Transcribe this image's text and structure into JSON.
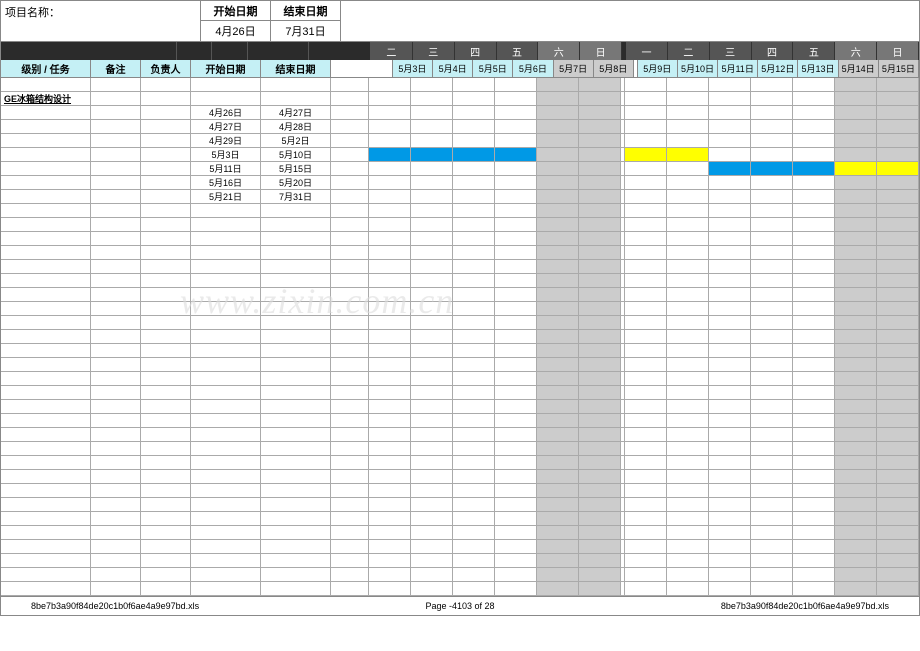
{
  "header": {
    "project_label": "项目名称：",
    "start_date_label": "开始日期",
    "end_date_label": "结束日期",
    "start_date": "4月26日",
    "end_date": "7月31日"
  },
  "columns": {
    "level_task": "级别 / 任务",
    "remark": "备注",
    "owner": "负责人",
    "start": "开始日期",
    "end": "结束日期"
  },
  "day_labels": [
    "二",
    "三",
    "四",
    "五",
    "六",
    "日",
    "一",
    "二",
    "三",
    "四",
    "五",
    "六",
    "日"
  ],
  "day_weekend": [
    false,
    false,
    false,
    false,
    true,
    true,
    false,
    false,
    false,
    false,
    false,
    true,
    true
  ],
  "date_labels": [
    "5月3日",
    "5月4日",
    "5月5日",
    "5月6日",
    "5月7日",
    "5月8日",
    "5月9日",
    "5月10日",
    "5月11日",
    "5月12日",
    "5月13日",
    "5月14日",
    "5月15日"
  ],
  "section_title": "GE冰箱结构设计",
  "tasks": [
    {
      "start": "4月26日",
      "end": "4月27日",
      "bars": []
    },
    {
      "start": "4月27日",
      "end": "4月28日",
      "bars": []
    },
    {
      "start": "4月29日",
      "end": "5月2日",
      "bars": []
    },
    {
      "start": "5月3日",
      "end": "5月10日",
      "bars": [
        {
          "from": 0,
          "to": 3,
          "color": "blue"
        },
        {
          "from": 6,
          "to": 7,
          "color": "yellow"
        }
      ]
    },
    {
      "start": "5月11日",
      "end": "5月15日",
      "bars": [
        {
          "from": 8,
          "to": 10,
          "color": "blue"
        },
        {
          "from": 11,
          "to": 12,
          "color": "yellow"
        }
      ]
    },
    {
      "start": "5月16日",
      "end": "5月20日",
      "bars": []
    },
    {
      "start": "5月21日",
      "end": "7月31日",
      "bars": []
    }
  ],
  "blank_rows": 28,
  "footer": {
    "filename": "8be7b3a90f84de20c1b0f6ae4a9e97bd.xls",
    "page": "Page -4103 of  28"
  },
  "watermark": "www.zixin.com.cn"
}
